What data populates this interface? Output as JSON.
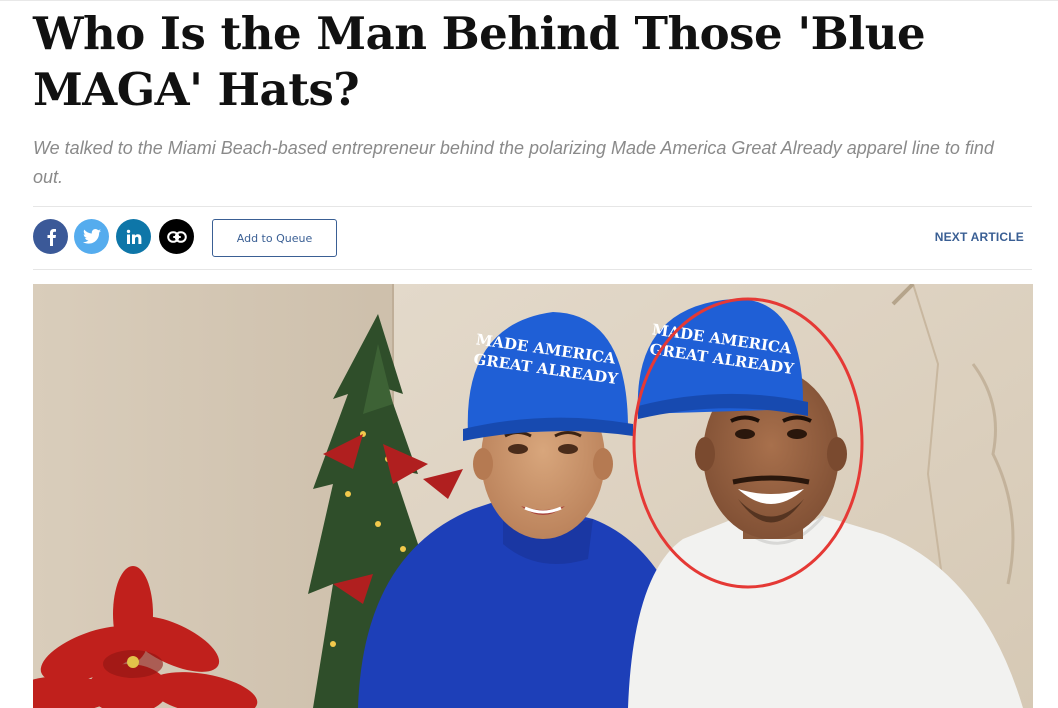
{
  "article": {
    "headline": "Who Is the Man Behind Those 'Blue MAGA' Hats?",
    "dek": "We talked to the Miami Beach-based entrepreneur behind the polarizing Made America Great Already apparel line to find out."
  },
  "share_bar": {
    "queue_label": "Add to Queue",
    "next_article_label": "NEXT ARTICLE",
    "icons": [
      "facebook-icon",
      "twitter-icon",
      "linkedin-icon",
      "link-icon"
    ]
  },
  "photo": {
    "hat_text_line1": "MADE AMERICA",
    "hat_text_line2": "GREAT ALREADY",
    "highlight_circle_color": "#e53935",
    "hat_color": "#1f5fd6"
  },
  "colors": {
    "accent": "#3a5f94",
    "facebook": "#3b5998",
    "twitter": "#55acee",
    "linkedin": "#0e76a8"
  }
}
